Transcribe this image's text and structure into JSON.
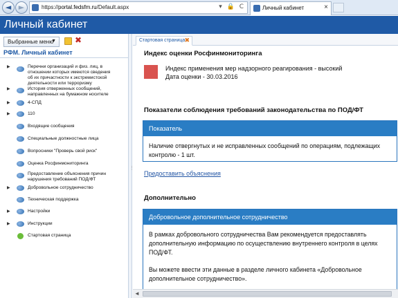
{
  "browser": {
    "url_prefix": "https://",
    "url_host": "portal.fedsfm.ru",
    "url_path": "/Default.aspx",
    "tab_title": "Личный кабинет",
    "tab_close": "×",
    "back": "◄",
    "forward": "►",
    "address_actions": "▾ 🔒 C"
  },
  "header": {
    "title": "Личный кабинет"
  },
  "left_panel": {
    "menu_button": "Выбранные меню",
    "menu_arrow": "▼",
    "delete_glyph": "✖",
    "title": "РФМ. Личный кабинет",
    "items": [
      {
        "label1": "Перечни организаций и физ. лиц, в",
        "label2": "отношении которых имеются сведения",
        "label3": "об их причастности к экстремистской",
        "label4": "деятельности или терроризму",
        "icon": "globe-icon",
        "expandable": true
      },
      {
        "label1": "История отверженных сообщений,",
        "label2": "направленных на бумажном носителе",
        "icon": "globe-icon",
        "expandable": true
      },
      {
        "label1": "4-СПД",
        "icon": "globe-icon",
        "expandable": true
      },
      {
        "label1": "110",
        "icon": "globe-icon",
        "expandable": true
      },
      {
        "label1": "Входящие сообщения",
        "icon": "globe-icon",
        "expandable": false
      },
      {
        "label1": "Специальные должностные лица",
        "icon": "globe-icon",
        "expandable": false
      },
      {
        "label1": "Вопросники \"Проверь свой риск\"",
        "icon": "globe-icon",
        "expandable": false
      },
      {
        "label1": "Оценка Росфинмониторинга",
        "icon": "globe-icon",
        "expandable": false
      },
      {
        "label1": "Предоставление объяснения причин",
        "label2": "нарушения требований ПОД/ФТ",
        "icon": "globe-icon",
        "expandable": false
      },
      {
        "label1": "Добровольное сотрудничество",
        "icon": "globe-icon",
        "expandable": true
      },
      {
        "label1": "Техническая поддержка",
        "icon": "globe-icon",
        "expandable": false
      },
      {
        "label1": "Настройки",
        "icon": "globe-icon",
        "expandable": true
      },
      {
        "label1": "Инструкции",
        "icon": "globe-icon",
        "expandable": true
      },
      {
        "label1": "Стартовая страница",
        "icon": "home-icon",
        "expandable": false
      }
    ],
    "toggle_glyph": "▶"
  },
  "tabs": {
    "start_label": "Стартовая страница",
    "close": "✖"
  },
  "main": {
    "index_title": "Индекс оценки Росфинмониторинга",
    "risk_color": "#d9534f",
    "risk_line1": "Индекс применения мер надзорного реагирования - высокий",
    "risk_line2": "Дата оценки - 30.03.2016",
    "compliance_title": "Показатели соблюдения требований законодательства по ПОД/ФТ",
    "indicator_header": "Показатель",
    "indicator_body": "Наличие отвергнутых и не исправленных сообщений по операциям, подлежащих контролю - 1 шт.",
    "explain_link": "Предоставить объяснения",
    "additional_title": "Дополнительно",
    "vol_header": "Добровольное дополнительное сотрудничество",
    "vol_p1": "В рамках добровольного сотрудничества Вам рекомендуется предоставлять дополнительную информацию по осуществлению внутреннего контроля в целях ПОД/ФТ.",
    "vol_p2": "Вы можете ввести эти данные в разделе личного кабинета «Добровольное дополнительное сотрудничество»."
  },
  "scroll": {
    "left_arrow": "◄"
  }
}
